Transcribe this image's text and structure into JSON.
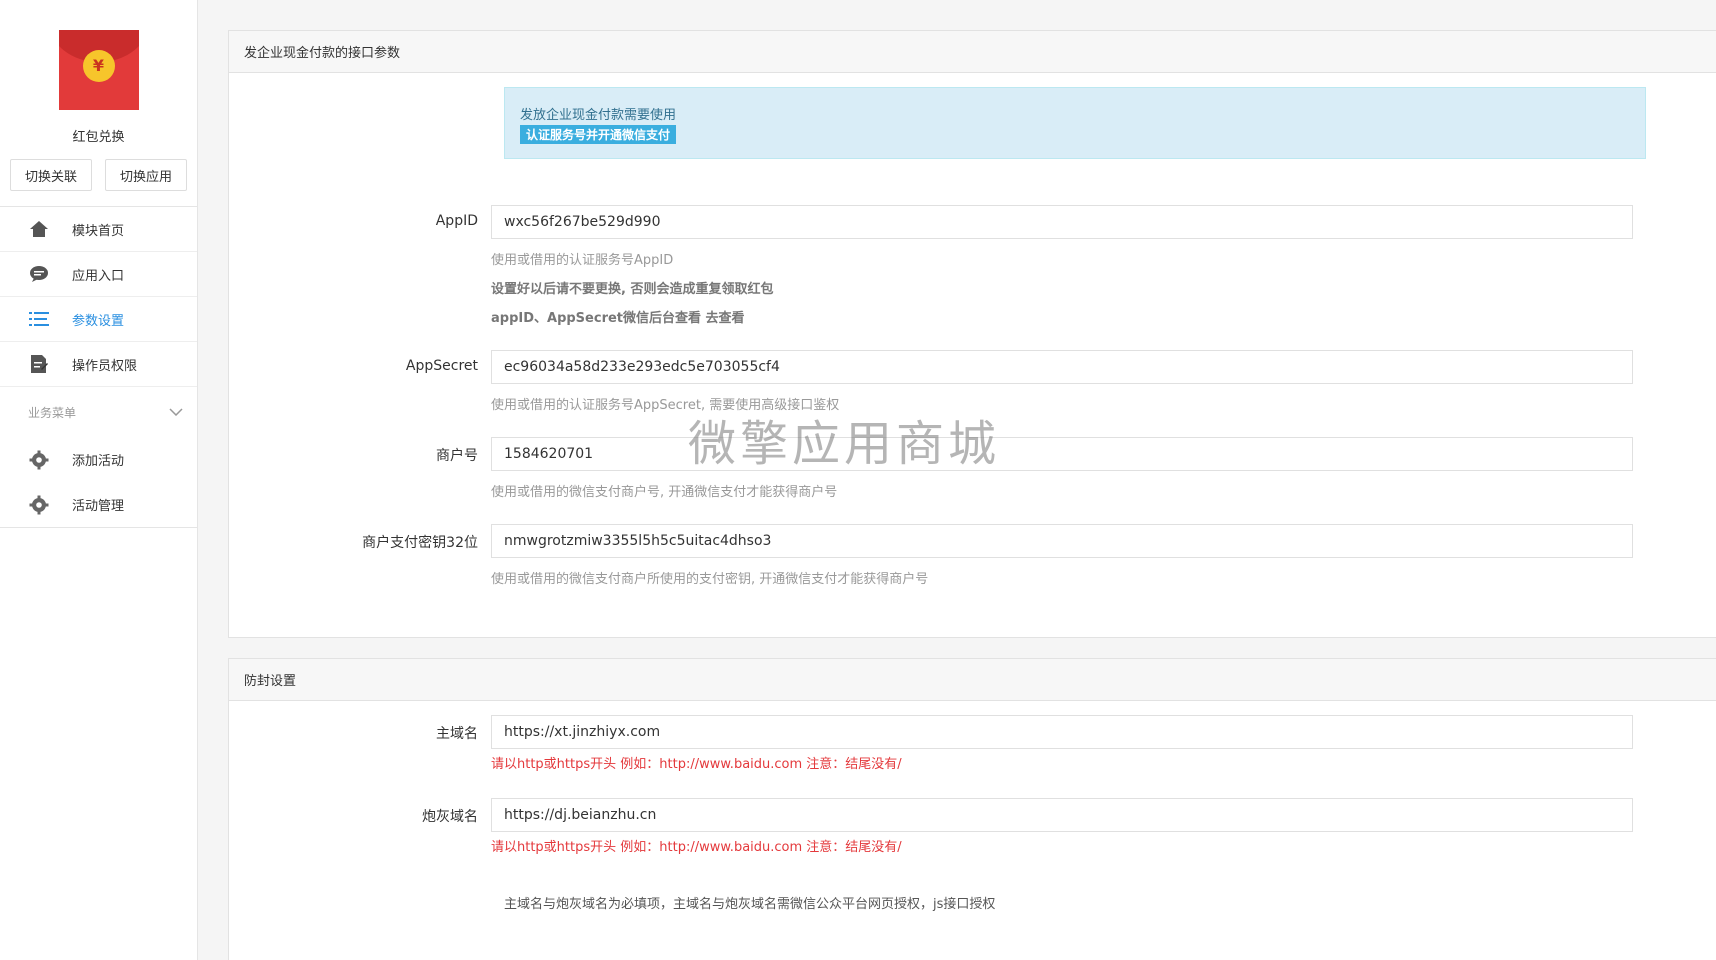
{
  "sidebar": {
    "app_name": "红包兑换",
    "switch_buttons": [
      "切换关联",
      "切换应用"
    ],
    "menu": [
      {
        "label": "模块首页",
        "icon": "home-icon"
      },
      {
        "label": "应用入口",
        "icon": "chat-icon"
      },
      {
        "label": "参数设置",
        "icon": "list-icon",
        "active": true
      },
      {
        "label": "操作员权限",
        "icon": "document-icon"
      }
    ],
    "group_title": "业务菜单",
    "group_items": [
      {
        "label": "添加活动",
        "icon": "gear-icon"
      },
      {
        "label": "活动管理",
        "icon": "gear-icon"
      }
    ]
  },
  "panel1": {
    "title": "发企业现金付款的接口参数",
    "alert_text": "发放企业现金付款需要使用",
    "alert_tag": "认证服务号并开通微信支付",
    "fields": [
      {
        "label": "AppID",
        "value": "wxc56f267be529d990"
      },
      {
        "label": "AppSecret",
        "value": "ec96034a58d233e293edc5e703055cf4"
      },
      {
        "label": "商户号",
        "value": "1584620701"
      },
      {
        "label": "商户支付密钥32位",
        "value": "nmwgrotzmiw3355l5h5c5uitac4dhso3"
      }
    ],
    "help": {
      "appid_1": "使用或借用的认证服务号AppID",
      "appid_2": "设置好以后请不要更换, 否则会造成重复领取红包",
      "appid_3": "appID、AppSecret微信后台查看 去查看",
      "secret": "使用或借用的认证服务号AppSecret, 需要使用高级接口鉴权",
      "mch": "使用或借用的微信支付商户号, 开通微信支付才能获得商户号",
      "key": "使用或借用的微信支付商户所使用的支付密钥, 开通微信支付才能获得商户号"
    }
  },
  "panel2": {
    "title": "防封设置",
    "fields": [
      {
        "label": "主域名",
        "value": "https://xt.jinzhiyx.com",
        "hint": "请以http或https开头 例如：http://www.baidu.com 注意：结尾没有/"
      },
      {
        "label": "炮灰域名",
        "value": "https://dj.beianzhu.cn",
        "hint": "请以http或https开头 例如：http://www.baidu.com 注意：结尾没有/"
      }
    ],
    "note": "主域名与炮灰域名为必填项，主域名与炮灰域名需微信公众平台网页授权，js接口授权"
  },
  "watermark": "微擎应用商城",
  "colors": {
    "accent": "#2a8fe0",
    "alert_bg": "#d9edf7",
    "hint_red": "#e4393c",
    "logo_red": "#e23a3a"
  }
}
